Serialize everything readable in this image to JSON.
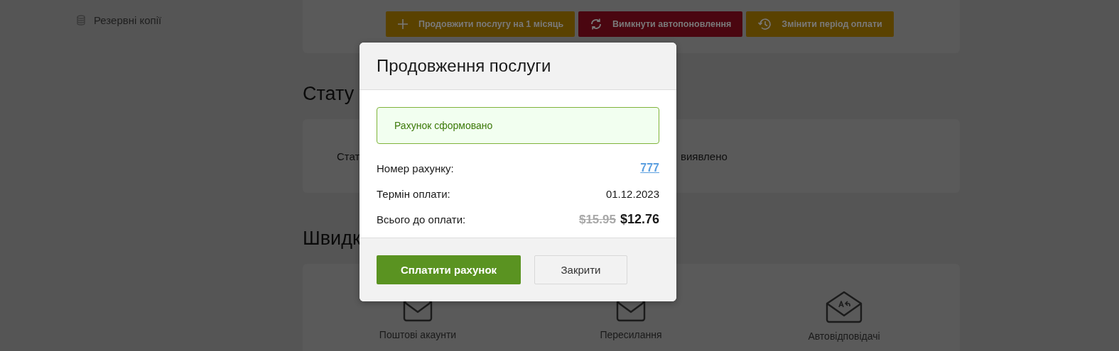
{
  "sidebar": {
    "items": [
      {
        "label": "Резервні копії"
      }
    ]
  },
  "actions": [
    {
      "kind": "add",
      "label": "Продовжити послугу на 1 місяць",
      "color": "#5a4200"
    },
    {
      "kind": "toggle",
      "label": "Вимкнути автопоновлення",
      "color": "#4a0610"
    },
    {
      "kind": "history",
      "label": "Змінити період оплати",
      "color": "#5a4200"
    }
  ],
  "status": {
    "heading": "Стату",
    "label": "Стат",
    "value": "виявлено"
  },
  "quick": {
    "heading": "Швидк",
    "items": [
      {
        "kind": "mail",
        "label": "Поштові акаунти"
      },
      {
        "kind": "mail",
        "label": "Пересилання"
      },
      {
        "kind": "autoreply",
        "label": "Автовідповідачі"
      }
    ]
  },
  "modal": {
    "title": "Продовження послуги",
    "alert": "Рахунок сформовано",
    "rows": [
      {
        "kind": "link",
        "label": "Номер рахунку:",
        "value": "777"
      },
      {
        "kind": "text",
        "label": "Термін оплати:",
        "value": "01.12.2023"
      },
      {
        "kind": "price",
        "label": "Всього до оплати:",
        "old_value": "$15.95",
        "value": "$12.76"
      }
    ],
    "buttons": [
      {
        "kind": "primary",
        "label": "Сплатити рахунок"
      },
      {
        "kind": "secondary",
        "label": "Закрити"
      }
    ]
  }
}
